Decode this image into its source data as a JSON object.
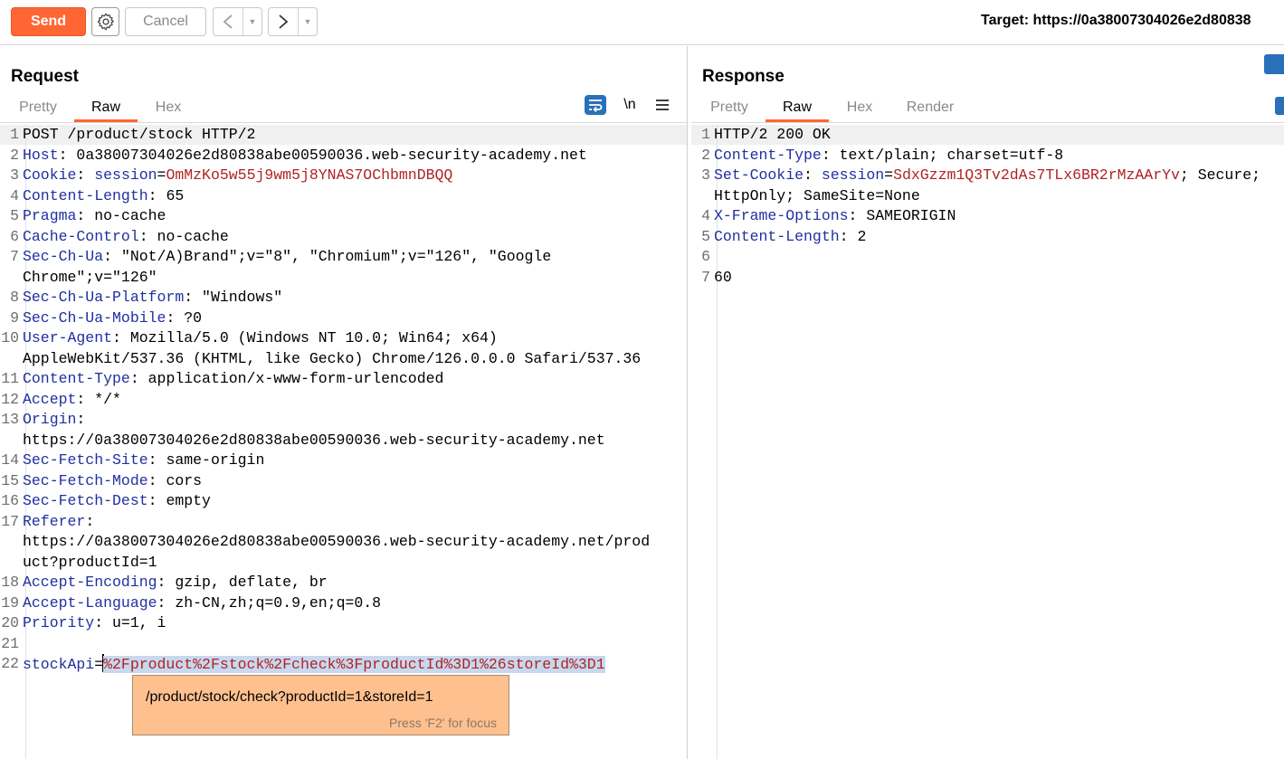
{
  "toolbar": {
    "send_label": "Send",
    "cancel_label": "Cancel",
    "prev_glyph": "<",
    "next_glyph": ">",
    "dropdown_glyph": "▼",
    "target_label": "Target: https://0a38007304026e2d80838"
  },
  "request": {
    "title": "Request",
    "tabs": [
      {
        "label": "Pretty",
        "active": false
      },
      {
        "label": "Raw",
        "active": true
      },
      {
        "label": "Hex",
        "active": false
      }
    ],
    "icons": [
      "wrap-lines-icon",
      "newline-toggle-icon",
      "menu-icon"
    ],
    "newline_label": "\\n",
    "lines": [
      {
        "n": "1",
        "key": "",
        "sep": "",
        "value": "POST /product/stock HTTP/2"
      },
      {
        "n": "2",
        "key": "Host",
        "sep": ": ",
        "value": "0a38007304026e2d80838abe00590036.web-security-academy.net"
      },
      {
        "n": "3",
        "key": "Cookie",
        "sep": ": ",
        "ck": "session",
        "cv": "OmMzKo5w55j9wm5j8YNAS7OChbmnDBQQ"
      },
      {
        "n": "4",
        "key": "Content-Length",
        "sep": ": ",
        "value": "65"
      },
      {
        "n": "5",
        "key": "Pragma",
        "sep": ": ",
        "value": "no-cache"
      },
      {
        "n": "6",
        "key": "Cache-Control",
        "sep": ": ",
        "value": "no-cache"
      },
      {
        "n": "7",
        "key": "Sec-Ch-Ua",
        "sep": ": ",
        "value": "\"Not/A)Brand\";v=\"8\", \"Chromium\";v=\"126\", \"Google"
      },
      {
        "n": "",
        "key": "",
        "sep": "",
        "value": "Chrome\";v=\"126\""
      },
      {
        "n": "8",
        "key": "Sec-Ch-Ua-Platform",
        "sep": ": ",
        "value": "\"Windows\""
      },
      {
        "n": "9",
        "key": "Sec-Ch-Ua-Mobile",
        "sep": ": ",
        "value": "?0"
      },
      {
        "n": "10",
        "key": "User-Agent",
        "sep": ": ",
        "value": "Mozilla/5.0 (Windows NT 10.0; Win64; x64)"
      },
      {
        "n": "",
        "key": "",
        "sep": "",
        "value": "AppleWebKit/537.36 (KHTML, like Gecko) Chrome/126.0.0.0 Safari/537.36"
      },
      {
        "n": "11",
        "key": "Content-Type",
        "sep": ": ",
        "value": "application/x-www-form-urlencoded"
      },
      {
        "n": "12",
        "key": "Accept",
        "sep": ": ",
        "value": "*/*"
      },
      {
        "n": "13",
        "key": "Origin",
        "sep": ":",
        "value": ""
      },
      {
        "n": "",
        "key": "",
        "sep": "",
        "value": "https://0a38007304026e2d80838abe00590036.web-security-academy.net"
      },
      {
        "n": "14",
        "key": "Sec-Fetch-Site",
        "sep": ": ",
        "value": "same-origin"
      },
      {
        "n": "15",
        "key": "Sec-Fetch-Mode",
        "sep": ": ",
        "value": "cors"
      },
      {
        "n": "16",
        "key": "Sec-Fetch-Dest",
        "sep": ": ",
        "value": "empty"
      },
      {
        "n": "17",
        "key": "Referer",
        "sep": ":",
        "value": ""
      },
      {
        "n": "",
        "key": "",
        "sep": "",
        "value": "https://0a38007304026e2d80838abe00590036.web-security-academy.net/prod"
      },
      {
        "n": "",
        "key": "",
        "sep": "",
        "value": "uct?productId=1"
      },
      {
        "n": "18",
        "key": "Accept-Encoding",
        "sep": ": ",
        "value": "gzip, deflate, br"
      },
      {
        "n": "19",
        "key": "Accept-Language",
        "sep": ": ",
        "value": "zh-CN,zh;q=0.9,en;q=0.8"
      },
      {
        "n": "20",
        "key": "Priority",
        "sep": ": ",
        "value": "u=1, i"
      },
      {
        "n": "21",
        "key": "",
        "sep": "",
        "value": ""
      },
      {
        "n": "22",
        "param": "stockApi",
        "eq": "=",
        "selected": "%2Fproduct%2Fstock%2Fcheck%3FproductId%3D1%26storeId%3D1"
      }
    ],
    "tooltip": {
      "decoded": "/product/stock/check?productId=1&storeId=1",
      "hint": "Press 'F2' for focus"
    }
  },
  "response": {
    "title": "Response",
    "tabs": [
      {
        "label": "Pretty",
        "active": false
      },
      {
        "label": "Raw",
        "active": true
      },
      {
        "label": "Hex",
        "active": false
      },
      {
        "label": "Render",
        "active": false
      }
    ],
    "lines": [
      {
        "n": "1",
        "key": "",
        "sep": "",
        "value": "HTTP/2 200 OK"
      },
      {
        "n": "2",
        "key": "Content-Type",
        "sep": ": ",
        "value": "text/plain; charset=utf-8"
      },
      {
        "n": "3",
        "key": "Set-Cookie",
        "sep": ": ",
        "ck": "session",
        "cv": "SdxGzzm1Q3Tv2dAs7TLx6BR2rMzAArYv",
        "tail": "; Secure;"
      },
      {
        "n": "",
        "key": "",
        "sep": "",
        "value": "HttpOnly; SameSite=None"
      },
      {
        "n": "4",
        "key": "X-Frame-Options",
        "sep": ": ",
        "value": "SAMEORIGIN"
      },
      {
        "n": "5",
        "key": "Content-Length",
        "sep": ": ",
        "value": "2"
      },
      {
        "n": "6",
        "key": "",
        "sep": "",
        "value": ""
      },
      {
        "n": "7",
        "key": "",
        "sep": "",
        "value": "60"
      }
    ]
  },
  "colors": {
    "accent": "#ff6633",
    "header_key": "#2030a0",
    "cookie_value": "#b02323",
    "tooltip_bg": "#ffc08f",
    "selection_bg": "#c8d8ee"
  }
}
